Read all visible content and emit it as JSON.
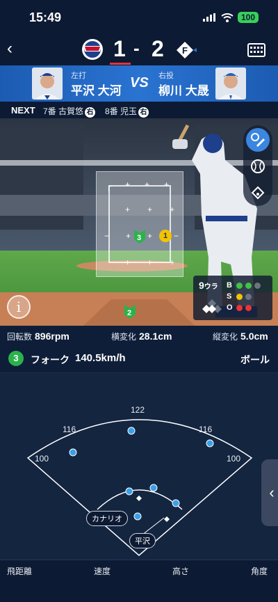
{
  "status": {
    "time": "15:49",
    "battery": "100"
  },
  "score": {
    "home": "1",
    "dash": "-",
    "away": "2",
    "home_team_logo_text": "Lions",
    "away_team_logo_text": "F"
  },
  "matchup": {
    "batter_role": "左打",
    "batter_name": "平沢 大河",
    "vs": "VS",
    "pitcher_role": "右投",
    "pitcher_name": "柳川 大晟"
  },
  "next": {
    "label": "NEXT",
    "items": [
      {
        "text": "7番 古賀悠",
        "hand": "右"
      },
      {
        "text": "8番 児玉",
        "hand": "右"
      }
    ]
  },
  "field": {
    "pitch_markers": [
      {
        "num": "3",
        "color": "#2bb24c"
      },
      {
        "num": "1",
        "color": "#f2c400"
      }
    ],
    "plate_marker": "2",
    "count": {
      "inning": "9",
      "half": "ウラ",
      "b_label": "B",
      "s_label": "S",
      "o_label": "O",
      "balls": 2,
      "strikes": 1,
      "outs": 2
    }
  },
  "stats": {
    "spin_label": "回転数",
    "spin": "896rpm",
    "hbreak_label": "横変化",
    "hbreak": "28.1cm",
    "vbreak_label": "縦変化",
    "vbreak": "5.0cm"
  },
  "pitch": {
    "number": "3",
    "type": "フォーク",
    "speed": "140.5km/h",
    "result": "ボール"
  },
  "spray": {
    "distances": {
      "left": "100",
      "left_center": "116",
      "center": "122",
      "right_center": "116",
      "right": "100"
    },
    "tags": {
      "fielder": "カナリオ",
      "batter": "平沢"
    }
  },
  "footer": {
    "tabs": [
      "飛距離",
      "速度",
      "高さ",
      "角度"
    ]
  },
  "colors": {
    "accent": "#2a73d1",
    "ball": "#3ec441",
    "strike": "#f2c400",
    "out": "#e33"
  }
}
